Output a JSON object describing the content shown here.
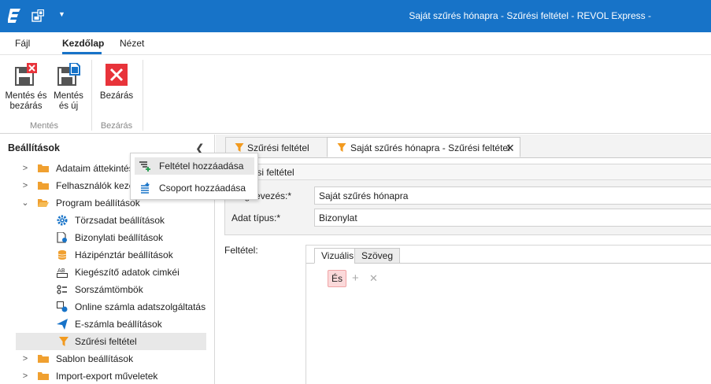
{
  "window": {
    "title": "Saját szűrés hónapra - Szűrési feltétel - REVOL Express -"
  },
  "menu": {
    "tabs": [
      {
        "label": "Fájl"
      },
      {
        "label": "Kezdőlap"
      },
      {
        "label": "Nézet"
      }
    ]
  },
  "ribbon": {
    "save_close": {
      "line1": "Mentés és",
      "line2": "bezárás"
    },
    "save_new": {
      "line1": "Mentés",
      "line2": "és új"
    },
    "close": {
      "label": "Bezárás"
    },
    "groups": [
      {
        "label": "Mentés"
      },
      {
        "label": "Bezárás"
      }
    ]
  },
  "sidebar": {
    "title": "Beállítások",
    "items": [
      {
        "label": "Adataim áttekintése",
        "icon": "folder-icon"
      },
      {
        "label": "Felhasználók kezelése",
        "icon": "folder-icon"
      },
      {
        "label": "Program beállítások",
        "icon": "folder-open-icon"
      },
      {
        "label": "Törzsadat beállítások",
        "icon": "gear-icon"
      },
      {
        "label": "Bizonylati beállítások",
        "icon": "document-settings-icon"
      },
      {
        "label": "Házipénztár beállítások",
        "icon": "coins-icon"
      },
      {
        "label": "Kiegészítő adatok cimkéi",
        "icon": "ab-label-icon"
      },
      {
        "label": "Sorszámtömbök",
        "icon": "number-series-icon"
      },
      {
        "label": "Online számla adatszolgáltatás",
        "icon": "online-service-icon"
      },
      {
        "label": "E-számla beállítások",
        "icon": "send-icon"
      },
      {
        "label": "Szűrési feltétel",
        "icon": "filter-icon"
      },
      {
        "label": "Sablon beállítások",
        "icon": "folder-icon"
      },
      {
        "label": "Import-export műveletek",
        "icon": "folder-icon"
      }
    ]
  },
  "tabs": [
    {
      "label": "Szűrési feltétel"
    },
    {
      "label": "Saját szűrés hónapra - Szűrési feltétel"
    }
  ],
  "form": {
    "section_title": "Szűrési feltétel",
    "name_label": "Megnevezés:*",
    "name_value": "Saját szűrés hónapra",
    "type_label": "Adat típus:*",
    "type_value": "Bizonylat",
    "condition_label": "Feltétel:"
  },
  "condition": {
    "tabs": [
      {
        "label": "Vizuális"
      },
      {
        "label": "Szöveg"
      }
    ],
    "operator": "És",
    "menu": [
      {
        "label": "Feltétel hozzáadása"
      },
      {
        "label": "Csoport hozzáadása"
      }
    ]
  },
  "colors": {
    "accent": "#1773c8",
    "close_red": "#e8333a",
    "filter_orange": "#f29a1f",
    "folder_orange": "#f0a030"
  }
}
